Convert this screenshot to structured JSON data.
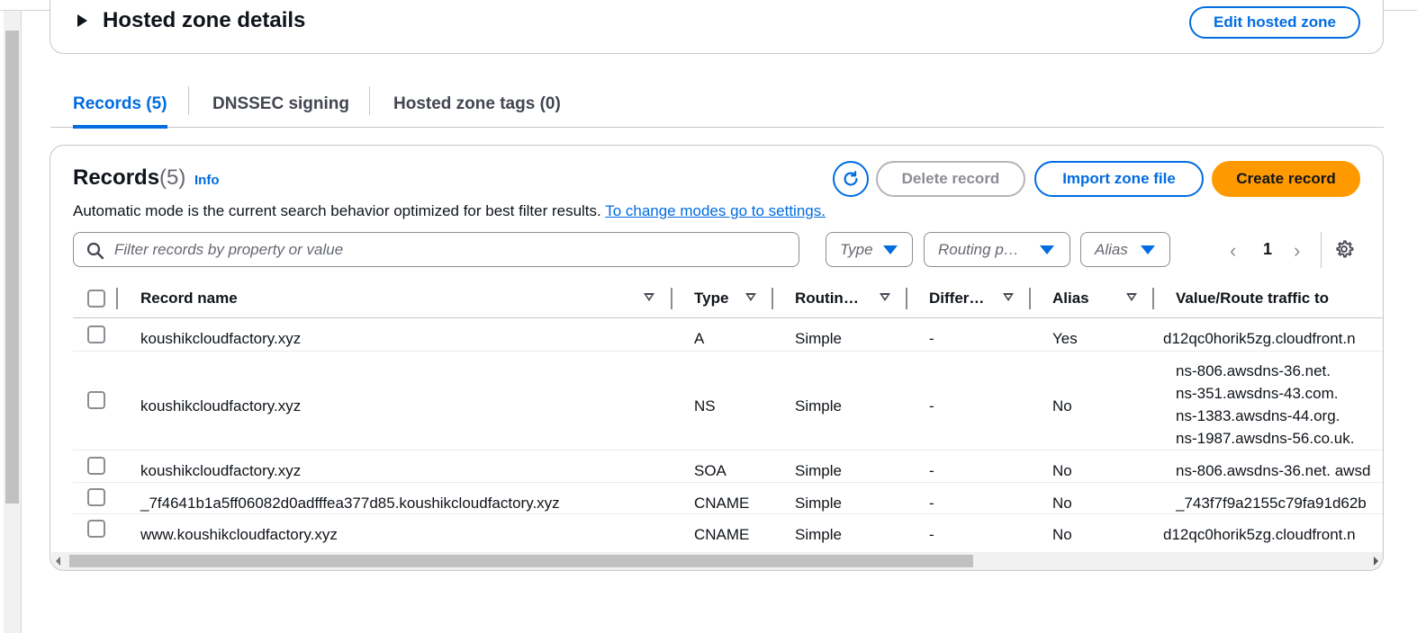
{
  "hosted_zone": {
    "title": "Hosted zone details",
    "edit_label": "Edit hosted zone"
  },
  "tabs": [
    {
      "label": "Records (5)",
      "active": true
    },
    {
      "label": "DNSSEC signing",
      "active": false
    },
    {
      "label": "Hosted zone tags (0)",
      "active": false
    }
  ],
  "records": {
    "title": "Records",
    "count": "(5)",
    "info": "Info",
    "delete_label": "Delete record",
    "import_label": "Import zone file",
    "create_label": "Create record",
    "mode_text": "Automatic mode is the current search behavior optimized for best filter results.",
    "mode_link": "To change modes go to settings.",
    "search_placeholder": "Filter records by property or value",
    "filters": {
      "type": "Type",
      "routing": "Routing p…",
      "alias": "Alias"
    },
    "page": "1"
  },
  "columns": {
    "name": "Record name",
    "type": "Type",
    "routing": "Routin…",
    "differ": "Differ…",
    "alias": "Alias",
    "value": "Value/Route traffic to"
  },
  "rows": [
    {
      "name": "koushikcloudfactory.xyz",
      "type": "A",
      "routing": "Simple",
      "differ": "-",
      "alias": "Yes",
      "value": "d12qc0horik5zg.cloudfront.n"
    },
    {
      "name": "koushikcloudfactory.xyz",
      "type": "NS",
      "routing": "Simple",
      "differ": "-",
      "alias": "No",
      "values": [
        "ns-806.awsdns-36.net.",
        "ns-351.awsdns-43.com.",
        "ns-1383.awsdns-44.org.",
        "ns-1987.awsdns-56.co.uk."
      ]
    },
    {
      "name": "koushikcloudfactory.xyz",
      "type": "SOA",
      "routing": "Simple",
      "differ": "-",
      "alias": "No",
      "value": "ns-806.awsdns-36.net. awsd"
    },
    {
      "name": "_7f4641b1a5ff06082d0adfffea377d85.koushikcloudfactory.xyz",
      "type": "CNAME",
      "routing": "Simple",
      "differ": "-",
      "alias": "No",
      "value": "_743f7f9a2155c79fa91d62b"
    },
    {
      "name": "www.koushikcloudfactory.xyz",
      "type": "CNAME",
      "routing": "Simple",
      "differ": "-",
      "alias": "No",
      "value": "d12qc0horik5zg.cloudfront.n"
    }
  ],
  "colors": {
    "accent": "#006ce0",
    "primary_button": "#ff9900",
    "border": "#c6c6cd"
  }
}
